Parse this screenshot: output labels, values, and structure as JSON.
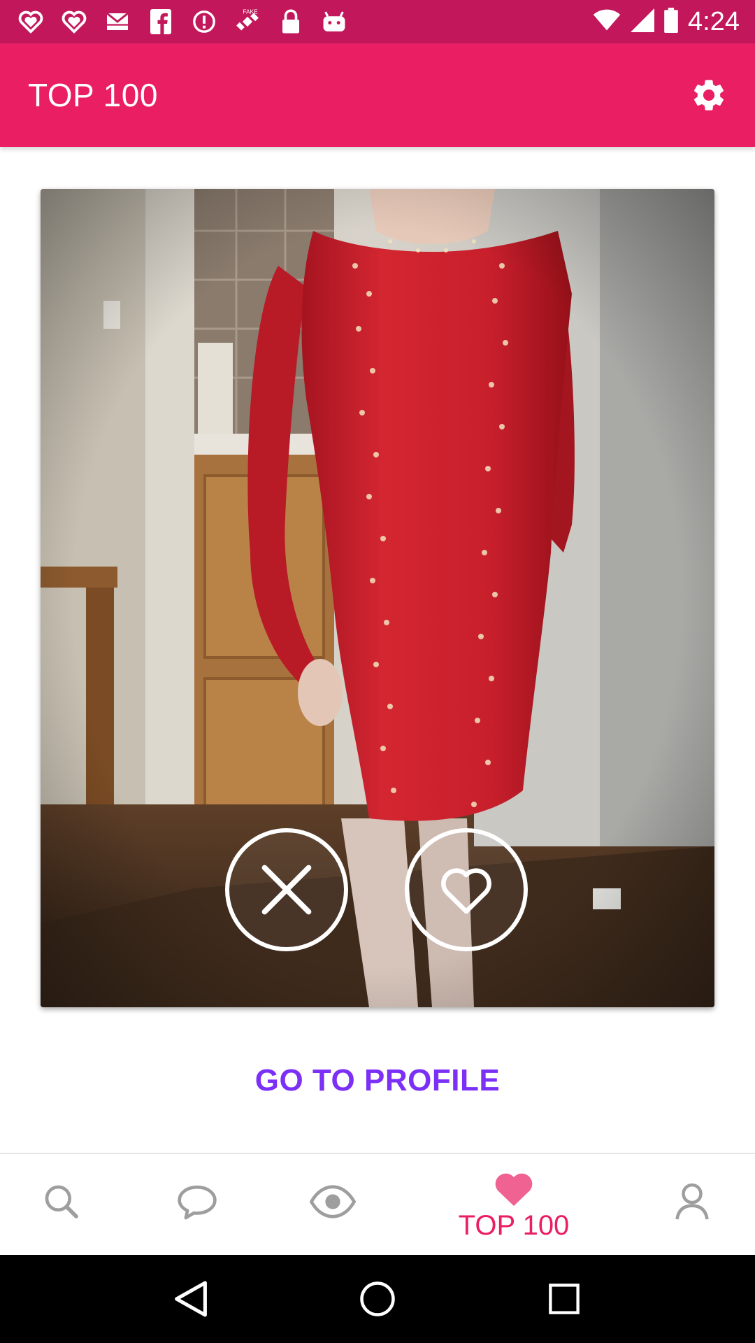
{
  "status_bar": {
    "time": "4:24",
    "icons": [
      "heart-outline-icon",
      "heart-outline-icon",
      "mail-icon",
      "facebook-icon",
      "alert-icon",
      "satellite-icon",
      "lock-icon",
      "android-icon",
      "wifi-icon",
      "signal-icon",
      "battery-icon"
    ],
    "satellite_badge": "FAKE"
  },
  "app_bar": {
    "title": "TOP 100",
    "settings_icon": "gear-icon"
  },
  "photo_card": {
    "dislike_icon": "close-icon",
    "like_icon": "heart-outline-icon"
  },
  "go_to_profile": "GO TO PROFILE",
  "bottom_nav": {
    "items": [
      {
        "icon": "search-icon"
      },
      {
        "icon": "chat-icon"
      },
      {
        "icon": "eye-icon"
      },
      {
        "icon": "heart-icon",
        "label": "TOP 100",
        "active": true
      },
      {
        "icon": "person-icon"
      }
    ]
  },
  "colors": {
    "status_bar": "#c2185b",
    "app_bar": "#e91e63",
    "accent_purple": "#7b2ff7",
    "active_pink": "#e91e63",
    "inactive_icon": "#9e9e9e"
  }
}
